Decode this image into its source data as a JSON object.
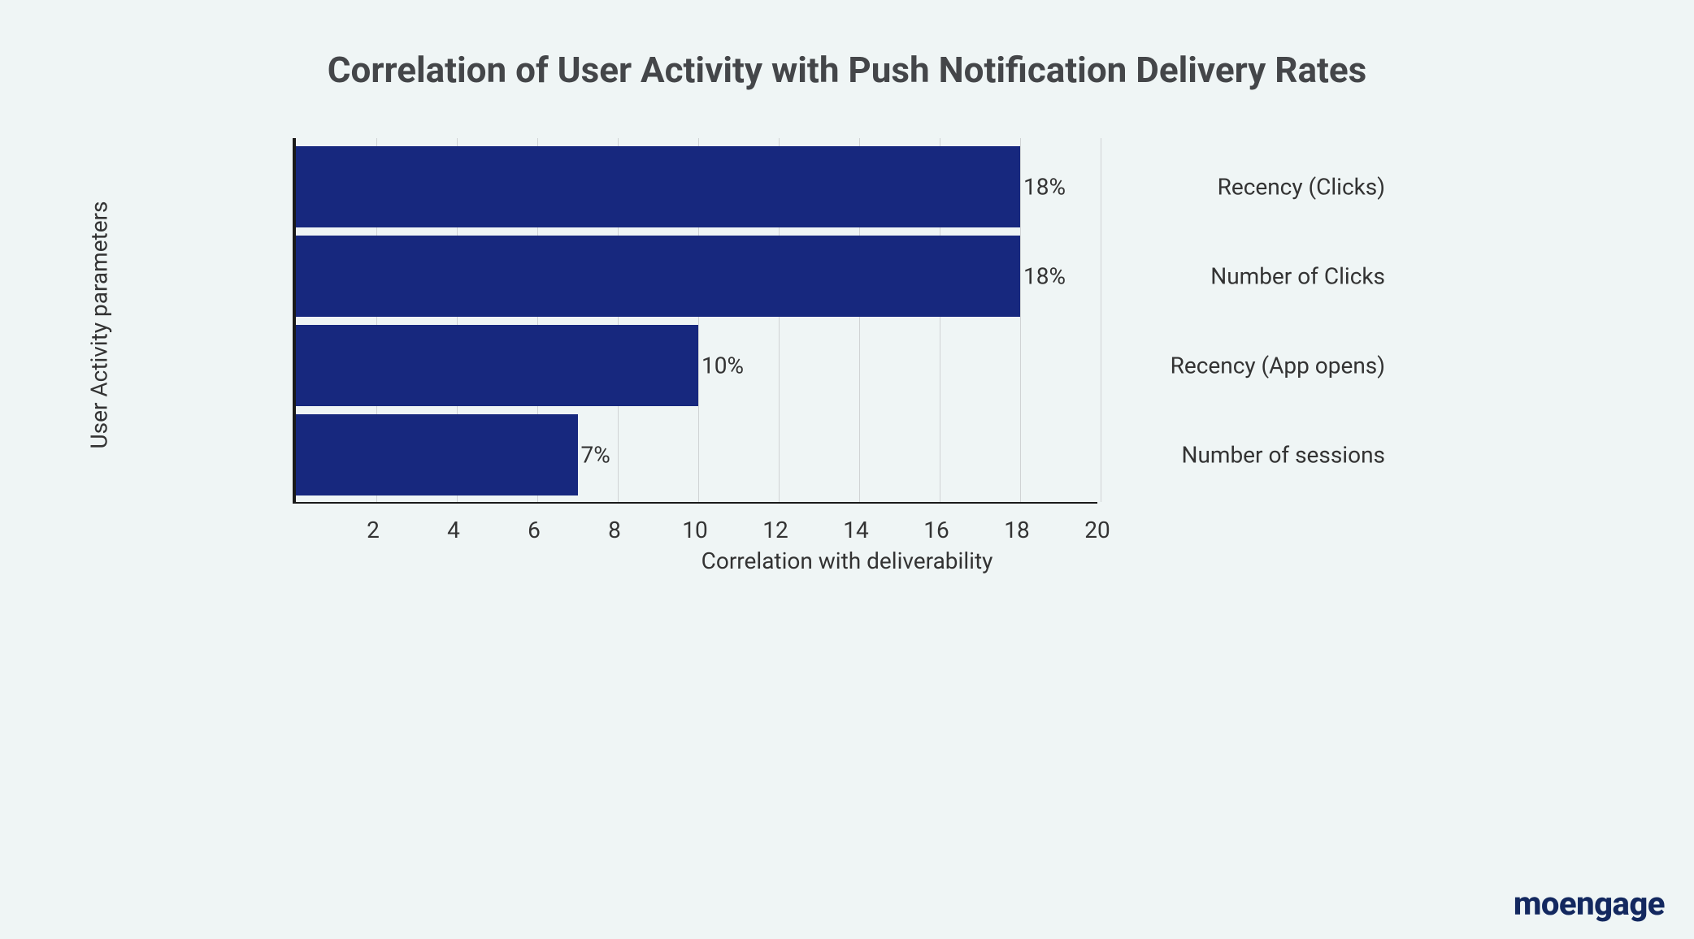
{
  "chart_data": {
    "type": "bar",
    "title": "Correlation of User Activity with Push Notification Delivery Rates",
    "xlabel": "Correlation with deliverability",
    "ylabel": "User Activity parameters",
    "xlim": [
      0,
      20
    ],
    "categories": [
      "Recency (Clicks)",
      "Number of Clicks",
      "Recency (App opens)",
      "Number of sessions"
    ],
    "values": [
      18,
      18,
      10,
      7
    ],
    "labels": [
      "18%",
      "18%",
      "10%",
      "7%"
    ],
    "xticks": [
      2,
      4,
      6,
      8,
      10,
      12,
      14,
      16,
      18,
      20
    ],
    "bar_color": "#17287e"
  },
  "brand": "moengage"
}
